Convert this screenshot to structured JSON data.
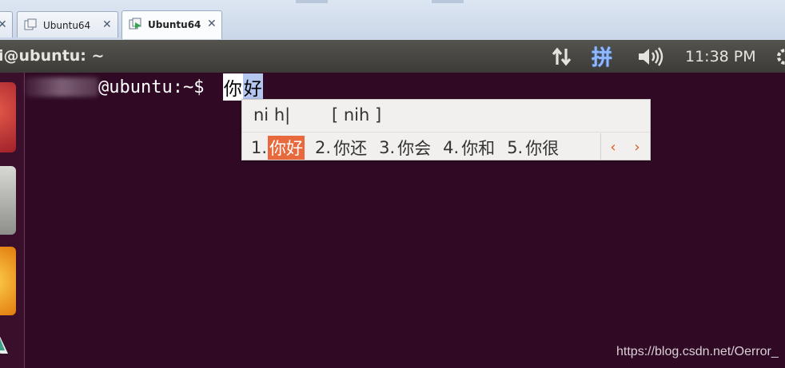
{
  "tabs": [
    {
      "label": "",
      "close": "✕"
    },
    {
      "label": "Ubuntu64",
      "close": "✕"
    },
    {
      "label": "Ubuntu64",
      "close": "✕",
      "active": true
    }
  ],
  "panel": {
    "window_title": "i@ubuntu: ~",
    "ime_indicator": "拼",
    "clock": "11:38 PM"
  },
  "terminal": {
    "prompt": "@ubuntu:~$ ",
    "preedit": [
      "你",
      "好"
    ]
  },
  "ime": {
    "typed": "ni h|",
    "raw": "[ nih ]",
    "candidates": [
      {
        "num": "1.",
        "text": "你好",
        "selected": true
      },
      {
        "num": "2.",
        "text": "你还"
      },
      {
        "num": "3.",
        "text": "你会"
      },
      {
        "num": "4.",
        "text": "你和"
      },
      {
        "num": "5.",
        "text": "你很"
      }
    ],
    "prev": "‹",
    "next": "›"
  },
  "watermark": "https://blog.csdn.net/Oerror_",
  "colors": {
    "terminal_bg": "#300a24",
    "candidate_highlight": "#e8693b",
    "panel_bg": "#3c3b37"
  }
}
